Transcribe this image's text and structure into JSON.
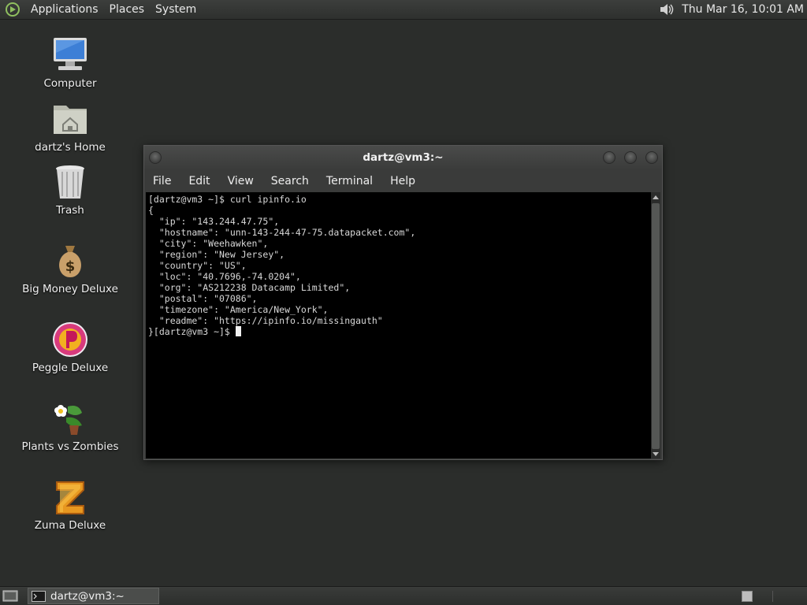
{
  "top_panel": {
    "menus": [
      "Applications",
      "Places",
      "System"
    ],
    "clock": "Thu Mar 16, 10:01 AM",
    "icons": {
      "logo": "distro-logo-icon",
      "volume": "volume-icon"
    }
  },
  "desktop": {
    "icons": [
      {
        "label": "Computer",
        "icon": "computer-icon"
      },
      {
        "label": "dartz's Home",
        "icon": "home-folder-icon"
      },
      {
        "label": "Trash",
        "icon": "trash-icon"
      },
      {
        "label": "Big Money Deluxe",
        "icon": "money-bag-icon"
      },
      {
        "label": "Peggle Deluxe",
        "icon": "peggle-icon"
      },
      {
        "label": "Plants vs Zombies",
        "icon": "plants-icon"
      },
      {
        "label": "Zuma Deluxe",
        "icon": "zuma-icon"
      }
    ]
  },
  "terminal": {
    "title": "dartz@vm3:~",
    "menu": [
      "File",
      "Edit",
      "View",
      "Search",
      "Terminal",
      "Help"
    ],
    "lines": [
      "[dartz@vm3 ~]$ curl ipinfo.io",
      "{",
      "  \"ip\": \"143.244.47.75\",",
      "  \"hostname\": \"unn-143-244-47-75.datapacket.com\",",
      "  \"city\": \"Weehawken\",",
      "  \"region\": \"New Jersey\",",
      "  \"country\": \"US\",",
      "  \"loc\": \"40.7696,-74.0204\",",
      "  \"org\": \"AS212238 Datacamp Limited\",",
      "  \"postal\": \"07086\",",
      "  \"timezone\": \"America/New_York\",",
      "  \"readme\": \"https://ipinfo.io/missingauth\""
    ],
    "prompt": "}[dartz@vm3 ~]$ "
  },
  "bottom_panel": {
    "task_label": "dartz@vm3:~"
  }
}
